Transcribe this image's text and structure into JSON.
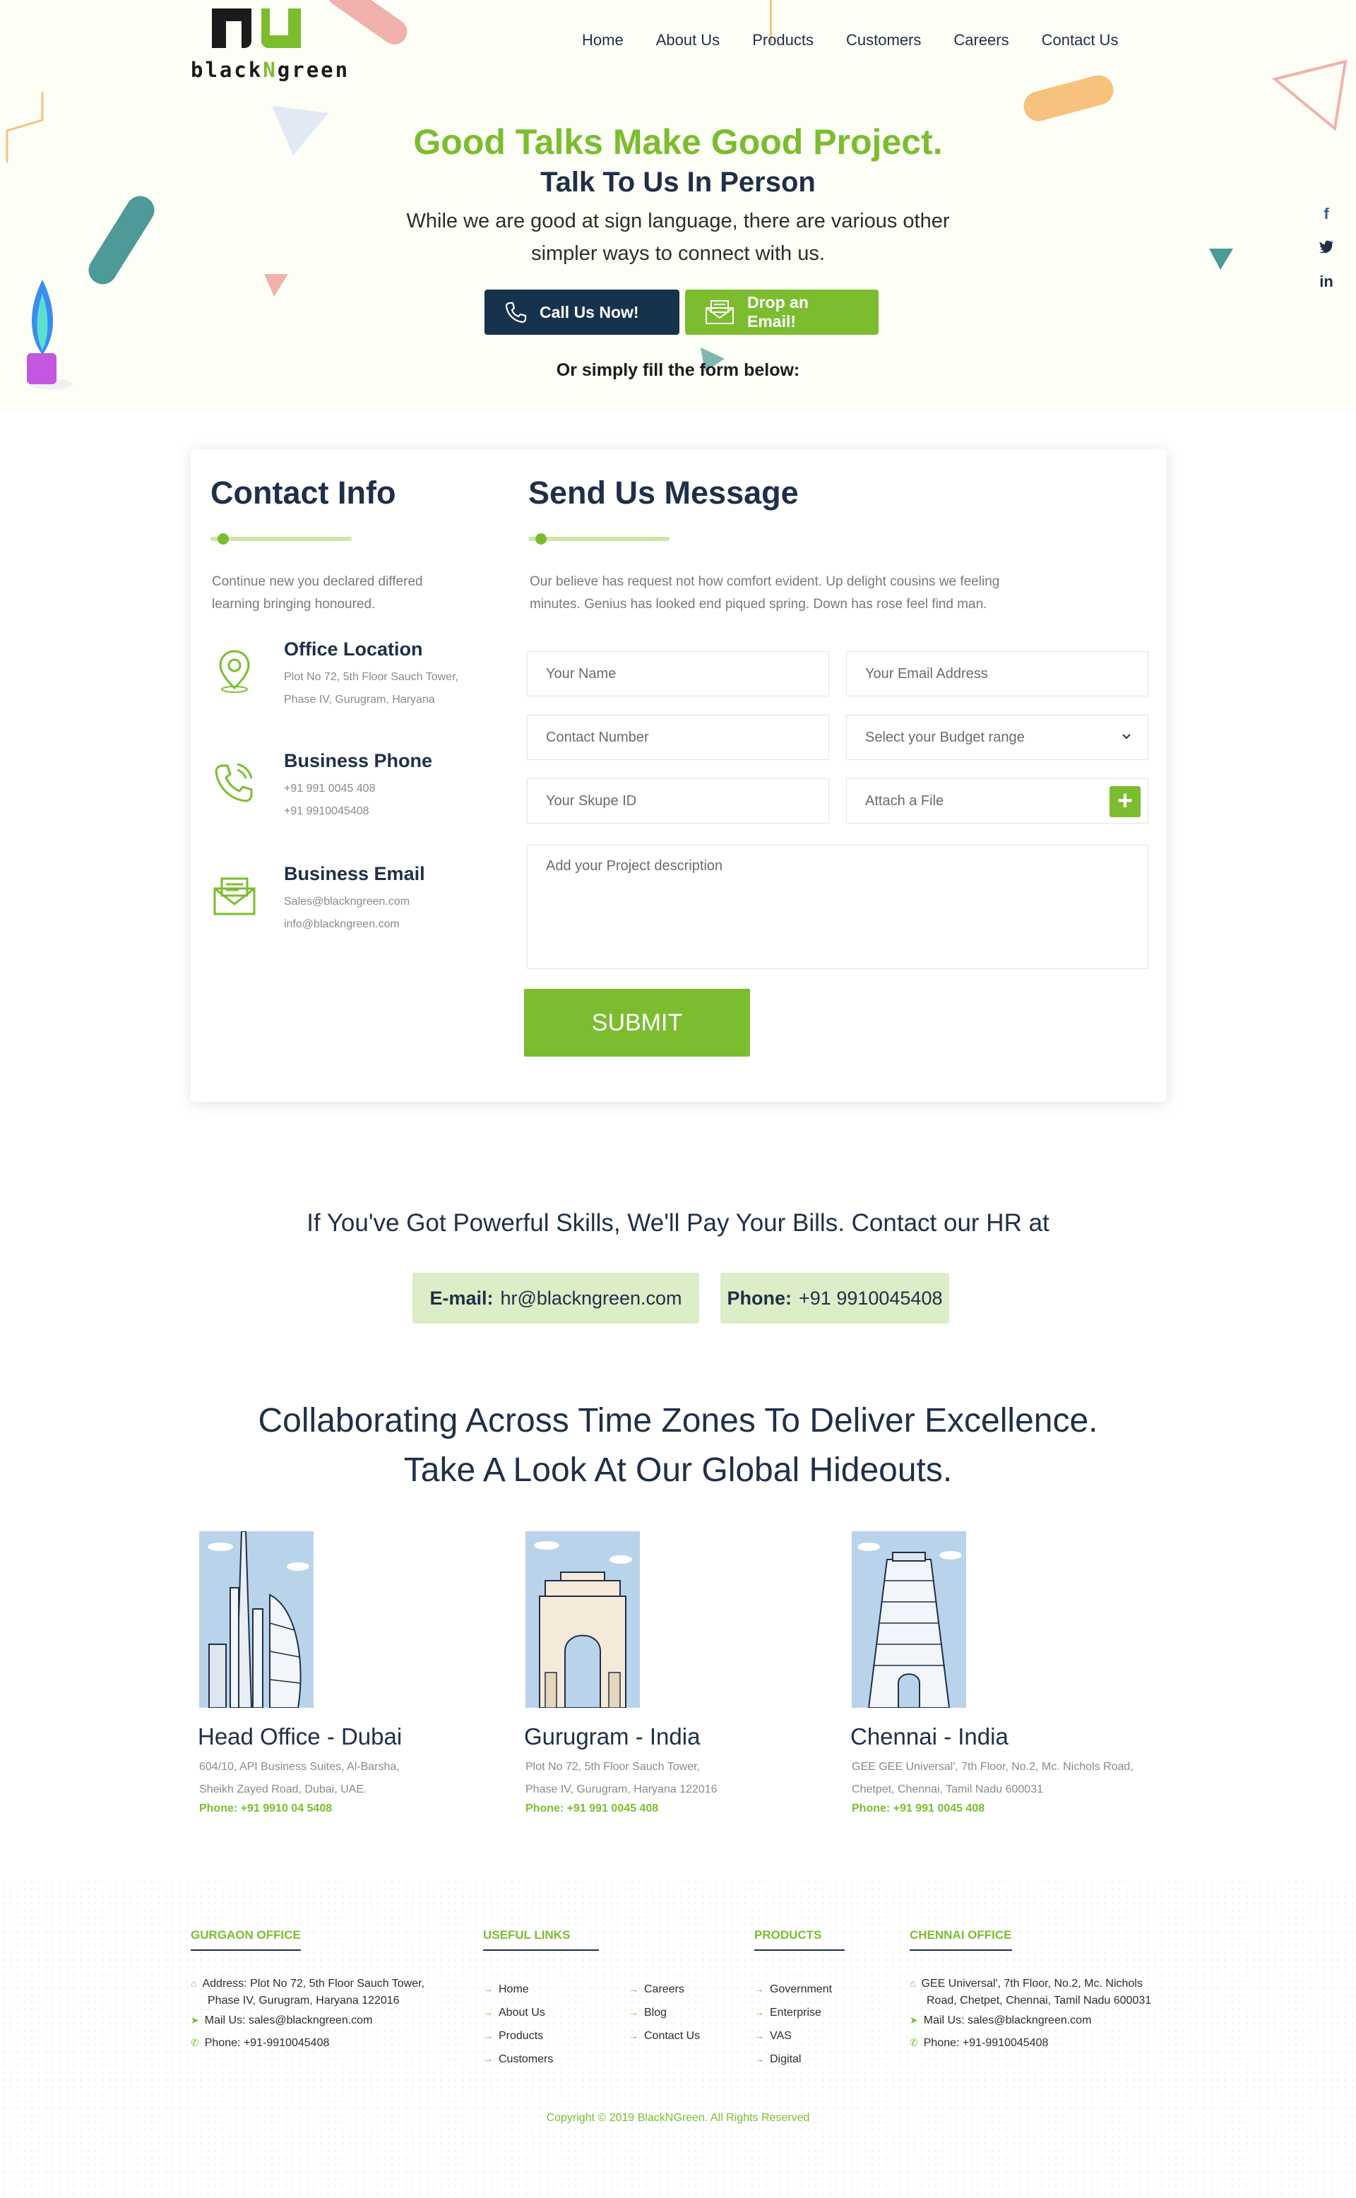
{
  "brand": {
    "logo_text_a": "black",
    "logo_text_b": "N",
    "logo_text_c": "green"
  },
  "nav": [
    "Home",
    "About Us",
    "Products",
    "Customers",
    "Careers",
    "Contact Us"
  ],
  "social": [
    "f",
    "t",
    "in"
  ],
  "hero": {
    "title": "Good Talks Make Good Project.",
    "subtitle": "Talk To Us In Person",
    "desc_line1": "While we are good at sign language, there are various other",
    "desc_line2": "simpler ways to connect with us.",
    "call_btn": "Call Us Now!",
    "email_btn": "Drop an Email!",
    "or_fill": "Or simply fill the form below:"
  },
  "contact_info": {
    "title": "Contact Info",
    "desc_line1": "Continue new you declared differed",
    "desc_line2": "learning bringing honoured.",
    "items": [
      {
        "title": "Office Location",
        "lines": [
          "Plot No 72, 5th Floor Sauch Tower,",
          "Phase IV, Gurugram, Haryana"
        ]
      },
      {
        "title": "Business Phone",
        "lines": [
          "+91 991 0045 408",
          "+91 9910045408"
        ]
      },
      {
        "title": "Business Email",
        "lines": [
          "Sales@blackngreen.com",
          "info@blackngreen.com"
        ]
      }
    ]
  },
  "message": {
    "title": "Send Us Message",
    "desc_line1": "Our believe has request not how comfort evident. Up delight cousins we feeling",
    "desc_line2": "minutes. Genius has looked end piqued spring. Down has rose feel find man.",
    "fields": {
      "name": "Your Name",
      "email": "Your Email Address",
      "contact": "Contact Number",
      "budget": "Select your Budget range",
      "skype": "Your Skupe ID",
      "attach": "Attach a File",
      "description": "Add your Project description"
    },
    "submit": "SUBMIT"
  },
  "hr": {
    "text": "If You've Got Powerful Skills, We'll Pay Your Bills. Contact our HR at",
    "email_label": "E-mail:",
    "email_value": "hr@blackngreen.com",
    "phone_label": "Phone:",
    "phone_value": "+91 9910045408"
  },
  "offices": {
    "title_line1": "Collaborating Across Time Zones To Deliver Excellence.",
    "title_line2": "Take A Look At Our Global Hideouts.",
    "list": [
      {
        "name": "Head Office - Dubai",
        "addr1": "604/10, API Business Suites, Al-Barsha,",
        "addr2": "Sheikh Zayed Road, Dubai, UAE.",
        "phone": "Phone: +91 9910 04 5408"
      },
      {
        "name": "Gurugram - India",
        "addr1": "Plot No 72, 5th Floor Sauch Tower,",
        "addr2": "Phase IV, Gurugram, Haryana 122016",
        "phone": "Phone: +91 991 0045 408"
      },
      {
        "name": "Chennai - India",
        "addr1": "GEE GEE Universal', 7th Floor, No.2, Mc. Nichols Road,",
        "addr2": "Chetpet, Chennai, Tamil Nadu 600031",
        "phone": "Phone: +91 991 0045 408"
      }
    ]
  },
  "footer": {
    "gurgaon": {
      "head": "GURGAON OFFICE",
      "addr_label": "Address:",
      "addr1": "Plot No 72, 5th Floor Sauch Tower,",
      "addr2": "Phase IV, Gurugram, Haryana 122016",
      "mail_label": "Mail Us:",
      "mail": "sales@blackngreen.com",
      "phone_label": "Phone:",
      "phone": "+91-9910045408"
    },
    "useful": {
      "head": "USEFUL LINKS",
      "col1": [
        "Home",
        "About Us",
        "Products",
        "Customers"
      ],
      "col2": [
        "Careers",
        "Blog",
        "Contact Us"
      ]
    },
    "products": {
      "head": "PRODUCTS",
      "items": [
        "Government",
        "Enterprise",
        "VAS",
        "Digital"
      ]
    },
    "chennai": {
      "head": "CHENNAI OFFICE",
      "addr1": "GEE Universal', 7th Floor, No.2, Mc. Nichols",
      "addr2": "Road, Chetpet, Chennai, Tamil Nadu 600031",
      "mail_label": "Mail Us:",
      "mail": "sales@blackngreen.com",
      "phone_label": "Phone:",
      "phone": "+91-9910045408"
    },
    "copyright": "Copyright © 2019 BlackNGreen. All Rights Reserved"
  },
  "colors": {
    "green": "#7bbd2f",
    "navy": "#17324d",
    "light_green": "#dcedc7"
  }
}
